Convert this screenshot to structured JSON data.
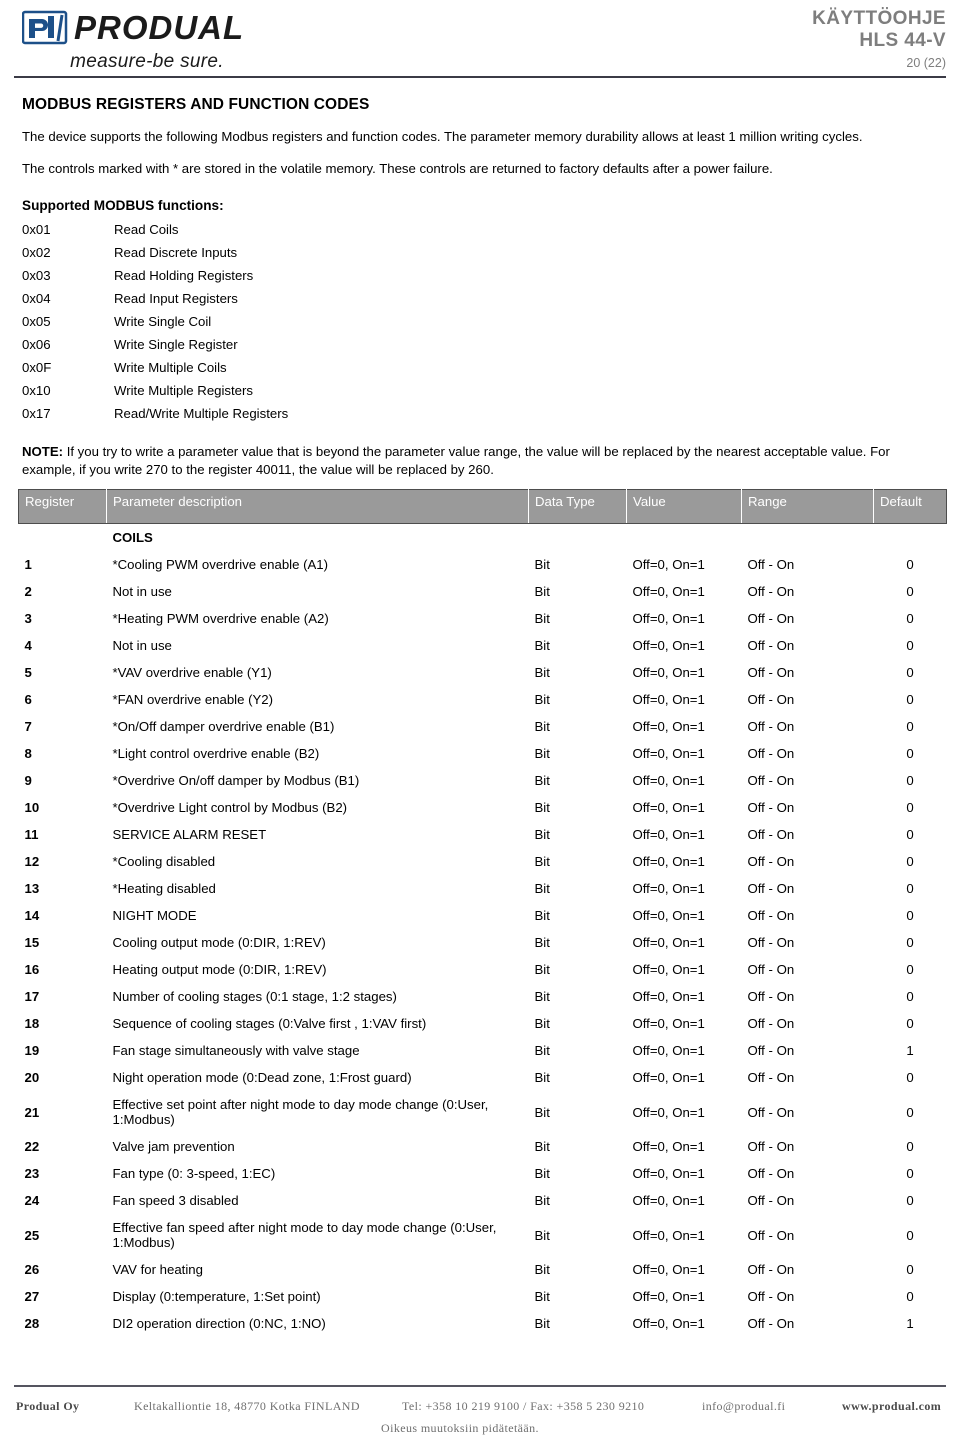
{
  "header": {
    "logo": {
      "mark_text": "pd",
      "wordmark": "PRODUAL",
      "tagline": "measure-be sure."
    },
    "doc_kind": "KÄYTTÖOHJE",
    "doc_model": "HLS 44-V",
    "page_label": "20 (22)"
  },
  "main": {
    "section_title": "MODBUS REGISTERS AND FUNCTION CODES",
    "paragraphs": [
      "The device supports the following Modbus registers and function codes. The parameter memory durability allows at least 1 million writing cycles.",
      "The controls marked with * are stored in the volatile memory. These controls are returned to factory defaults after a power failure."
    ],
    "functions_title": "Supported MODBUS functions:",
    "functions": [
      {
        "code": "0x01",
        "label": "Read Coils"
      },
      {
        "code": "0x02",
        "label": "Read Discrete Inputs"
      },
      {
        "code": "0x03",
        "label": "Read Holding Registers"
      },
      {
        "code": "0x04",
        "label": "Read Input Registers"
      },
      {
        "code": "0x05",
        "label": "Write Single Coil"
      },
      {
        "code": "0x06",
        "label": "Write Single Register"
      },
      {
        "code": "0x0F",
        "label": "Write Multiple Coils"
      },
      {
        "code": "0x10",
        "label": "Write Multiple Registers"
      },
      {
        "code": "0x17",
        "label": "Read/Write Multiple Registers"
      }
    ],
    "note_prefix": "NOTE:",
    "note_text": " If you try to write a parameter value that is beyond the parameter value range, the value will be replaced by the nearest acceptable value. For example, if you write 270 to the register 40011, the value will be replaced by 260."
  },
  "table": {
    "columns": [
      "Register",
      "Parameter description",
      "Data Type",
      "Value",
      "Range",
      "Default"
    ],
    "group_label": "COILS",
    "rows": [
      {
        "register": "1",
        "description": "*Cooling PWM overdrive enable (A1)",
        "data_type": "Bit",
        "value": "Off=0, On=1",
        "range": "Off - On",
        "default": "0"
      },
      {
        "register": "2",
        "description": "Not in use",
        "data_type": "Bit",
        "value": "Off=0, On=1",
        "range": "Off - On",
        "default": "0"
      },
      {
        "register": "3",
        "description": "*Heating PWM overdrive enable (A2)",
        "data_type": "Bit",
        "value": "Off=0, On=1",
        "range": "Off - On",
        "default": "0"
      },
      {
        "register": "4",
        "description": "Not in use",
        "data_type": "Bit",
        "value": "Off=0, On=1",
        "range": "Off - On",
        "default": "0"
      },
      {
        "register": "5",
        "description": "*VAV overdrive enable (Y1)",
        "data_type": "Bit",
        "value": "Off=0, On=1",
        "range": "Off - On",
        "default": "0"
      },
      {
        "register": "6",
        "description": "*FAN overdrive enable (Y2)",
        "data_type": "Bit",
        "value": "Off=0, On=1",
        "range": "Off - On",
        "default": "0"
      },
      {
        "register": "7",
        "description": "*On/Off damper overdrive enable (B1)",
        "data_type": "Bit",
        "value": "Off=0, On=1",
        "range": "Off - On",
        "default": "0"
      },
      {
        "register": "8",
        "description": "*Light control overdrive enable (B2)",
        "data_type": "Bit",
        "value": "Off=0, On=1",
        "range": "Off - On",
        "default": "0"
      },
      {
        "register": "9",
        "description": "*Overdrive On/off damper by Modbus (B1)",
        "data_type": "Bit",
        "value": "Off=0, On=1",
        "range": "Off - On",
        "default": "0"
      },
      {
        "register": "10",
        "description": "*Overdrive Light control by Modbus (B2)",
        "data_type": "Bit",
        "value": "Off=0, On=1",
        "range": "Off - On",
        "default": "0"
      },
      {
        "register": "11",
        "description": "SERVICE ALARM RESET",
        "data_type": "Bit",
        "value": "Off=0, On=1",
        "range": "Off - On",
        "default": "0"
      },
      {
        "register": "12",
        "description": "*Cooling disabled",
        "data_type": "Bit",
        "value": "Off=0, On=1",
        "range": "Off - On",
        "default": "0"
      },
      {
        "register": "13",
        "description": "*Heating disabled",
        "data_type": "Bit",
        "value": "Off=0, On=1",
        "range": "Off - On",
        "default": "0"
      },
      {
        "register": "14",
        "description": "NIGHT MODE",
        "data_type": "Bit",
        "value": "Off=0, On=1",
        "range": "Off - On",
        "default": "0"
      },
      {
        "register": "15",
        "description": "Cooling output mode (0:DIR, 1:REV)",
        "data_type": "Bit",
        "value": "Off=0, On=1",
        "range": "Off - On",
        "default": "0"
      },
      {
        "register": "16",
        "description": "Heating output mode (0:DIR, 1:REV)",
        "data_type": "Bit",
        "value": "Off=0, On=1",
        "range": "Off - On",
        "default": "0"
      },
      {
        "register": "17",
        "description": "Number of cooling stages (0:1 stage, 1:2 stages)",
        "data_type": "Bit",
        "value": "Off=0, On=1",
        "range": "Off - On",
        "default": "0"
      },
      {
        "register": "18",
        "description": "Sequence of cooling stages (0:Valve first , 1:VAV first)",
        "data_type": "Bit",
        "value": "Off=0, On=1",
        "range": "Off - On",
        "default": "0"
      },
      {
        "register": "19",
        "description": "Fan stage simultaneously with valve stage",
        "data_type": "Bit",
        "value": "Off=0, On=1",
        "range": "Off - On",
        "default": "1"
      },
      {
        "register": "20",
        "description": "Night operation mode (0:Dead zone, 1:Frost guard)",
        "data_type": "Bit",
        "value": "Off=0, On=1",
        "range": "Off - On",
        "default": "0"
      },
      {
        "register": "21",
        "description": "Effective set point after night mode to day mode change (0:User, 1:Modbus)",
        "data_type": "Bit",
        "value": "Off=0, On=1",
        "range": "Off - On",
        "default": "0"
      },
      {
        "register": "22",
        "description": "Valve jam prevention",
        "data_type": "Bit",
        "value": "Off=0, On=1",
        "range": "Off - On",
        "default": "0"
      },
      {
        "register": "23",
        "description": "Fan type (0: 3-speed, 1:EC)",
        "data_type": "Bit",
        "value": "Off=0, On=1",
        "range": "Off - On",
        "default": "0"
      },
      {
        "register": "24",
        "description": "Fan speed 3 disabled",
        "data_type": "Bit",
        "value": "Off=0, On=1",
        "range": "Off - On",
        "default": "0"
      },
      {
        "register": "25",
        "description": "Effective fan speed after night mode to day mode change (0:User, 1:Modbus)",
        "data_type": "Bit",
        "value": "Off=0, On=1",
        "range": "Off - On",
        "default": "0"
      },
      {
        "register": "26",
        "description": "VAV for heating",
        "data_type": "Bit",
        "value": "Off=0, On=1",
        "range": "Off - On",
        "default": "0"
      },
      {
        "register": "27",
        "description": "Display (0:temperature, 1:Set point)",
        "data_type": "Bit",
        "value": "Off=0, On=1",
        "range": "Off - On",
        "default": "0"
      },
      {
        "register": "28",
        "description": "DI2 operation direction (0:NC, 1:NO)",
        "data_type": "Bit",
        "value": "Off=0, On=1",
        "range": "Off - On",
        "default": "1"
      }
    ]
  },
  "footer": {
    "company": "Produal Oy",
    "address": "Keltakalliontie 18, 48770 Kotka FINLAND",
    "phone": "Tel: +358 10 219 9100 / Fax: +358 5 230 9210",
    "email": "info@produal.fi",
    "website": "www.produal.com",
    "disclaimer": "Oikeus muutoksiin pidätetään."
  },
  "colors": {
    "table_header_bg": "#9a9a9a",
    "header_text": "#7e7e7e",
    "rule": "#3b3b46",
    "logo_blue": "#1d5089"
  }
}
